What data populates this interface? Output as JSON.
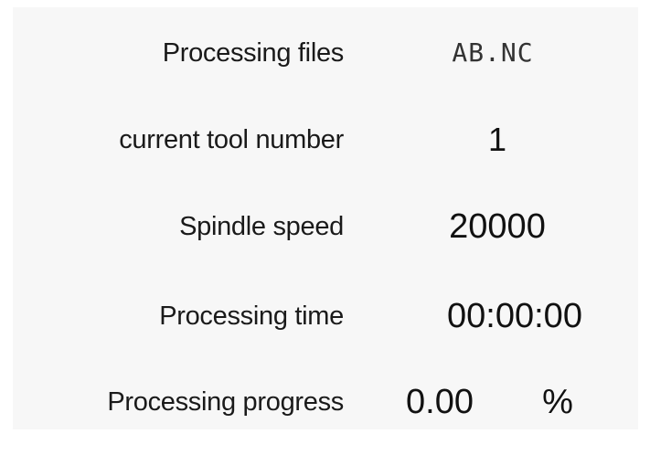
{
  "rows": {
    "file": {
      "label": "Processing files",
      "value": "AB.NC"
    },
    "tool": {
      "label": "current tool number",
      "value": "1"
    },
    "speed": {
      "label": "Spindle speed",
      "value": "20000"
    },
    "time": {
      "label": "Processing time",
      "value": "00:00:00"
    },
    "progress": {
      "label": "Processing progress",
      "value": "0.00",
      "unit": "%"
    }
  },
  "colors": {
    "panel_background": "#f7f7f7",
    "text": "#1a1a1a"
  }
}
